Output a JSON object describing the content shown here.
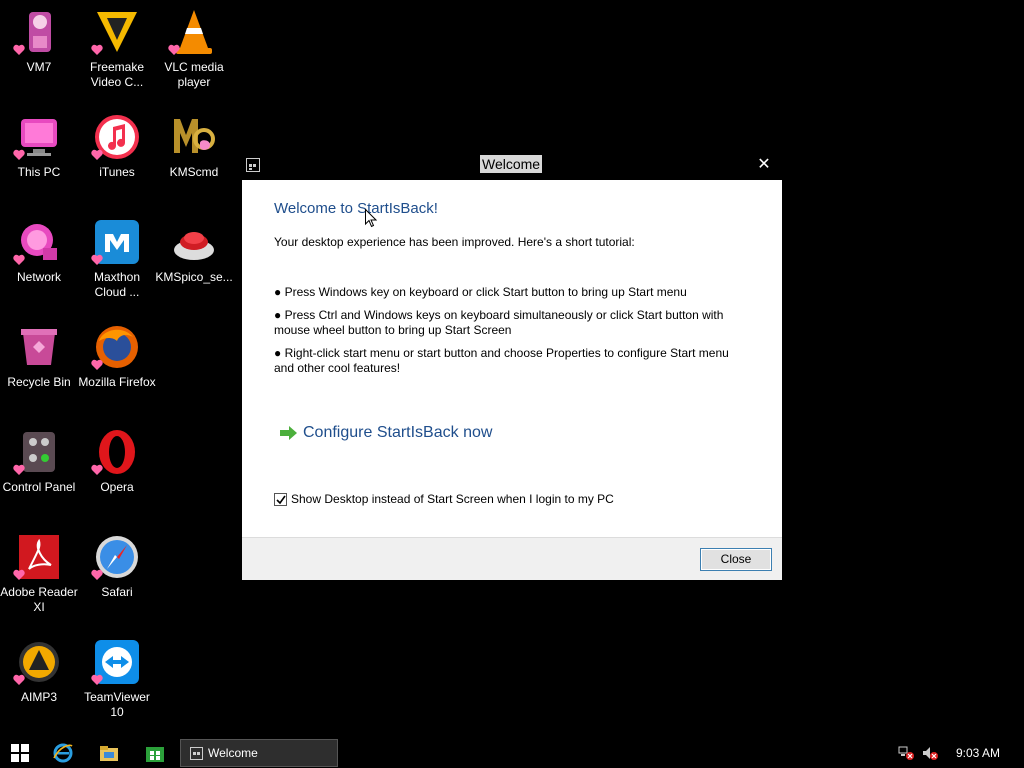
{
  "desktop": {
    "icons": [
      {
        "label": "VM7",
        "icon": "vm7-icon"
      },
      {
        "label": "Freemake Video C...",
        "icon": "freemake-icon"
      },
      {
        "label": "VLC media player",
        "icon": "vlc-icon"
      },
      {
        "label": "This PC",
        "icon": "this-pc-icon"
      },
      {
        "label": "iTunes",
        "icon": "itunes-icon"
      },
      {
        "label": "KMScmd",
        "icon": "kmscmd-icon"
      },
      {
        "label": "Network",
        "icon": "network-icon"
      },
      {
        "label": "Maxthon Cloud ...",
        "icon": "maxthon-icon"
      },
      {
        "label": "KMSpico_se...",
        "icon": "kmspico-icon"
      },
      {
        "label": "Recycle Bin",
        "icon": "recycle-bin-icon"
      },
      {
        "label": "Mozilla Firefox",
        "icon": "firefox-icon"
      },
      {
        "label": "Control Panel",
        "icon": "control-panel-icon"
      },
      {
        "label": "Opera",
        "icon": "opera-icon"
      },
      {
        "label": "Adobe Reader XI",
        "icon": "adobe-reader-icon"
      },
      {
        "label": "Safari",
        "icon": "safari-icon"
      },
      {
        "label": "AIMP3",
        "icon": "aimp-icon"
      },
      {
        "label": "TeamViewer 10",
        "icon": "teamviewer-icon"
      }
    ]
  },
  "dialog": {
    "title": "Welcome",
    "heading": "Welcome to StartIsBack!",
    "intro": "Your desktop experience has been improved. Here's a short tutorial:",
    "bullets": [
      "● Press Windows key on keyboard or click Start button to bring up Start menu",
      "● Press Ctrl and Windows keys on keyboard simultaneously or click Start button with mouse wheel button to bring up Start Screen",
      "● Right-click start menu or start button and choose Properties to configure Start menu and other cool features!"
    ],
    "configure_link": "Configure StartIsBack now",
    "checkbox_label": "Show Desktop instead of Start Screen when I login to my PC",
    "checkbox_checked": true,
    "close_button": "Close",
    "close_glyph": "✕"
  },
  "taskbar": {
    "active_task": "Welcome",
    "time": "9:03 AM"
  },
  "colors": {
    "accent": "#1f4e8c",
    "link_arrow": "#4caf3c",
    "background": "#000000"
  }
}
